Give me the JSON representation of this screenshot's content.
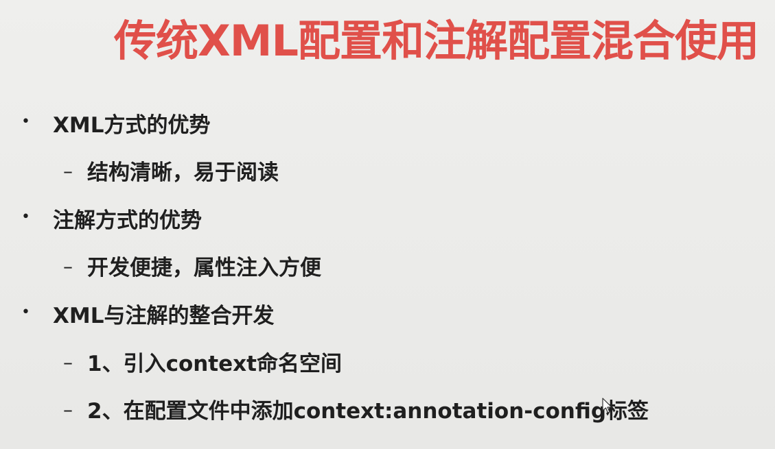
{
  "slide": {
    "title": "传统XML配置和注解配置混合使用",
    "items": [
      {
        "level": 1,
        "text": "XML方式的优势"
      },
      {
        "level": 2,
        "text": "结构清晰，易于阅读"
      },
      {
        "level": 1,
        "text": "注解方式的优势"
      },
      {
        "level": 2,
        "text": "开发便捷，属性注入方便"
      },
      {
        "level": 1,
        "text": "XML与注解的整合开发"
      },
      {
        "level": 2,
        "text": "1、引入context命名空间"
      },
      {
        "level": 2,
        "text": "2、在配置文件中添加context:annotation-config标签"
      }
    ],
    "bullet_symbol": "•",
    "dash_symbol": "–",
    "colors": {
      "title": "#e0504a",
      "text": "#1f1f1f",
      "background": "#ececea"
    }
  }
}
